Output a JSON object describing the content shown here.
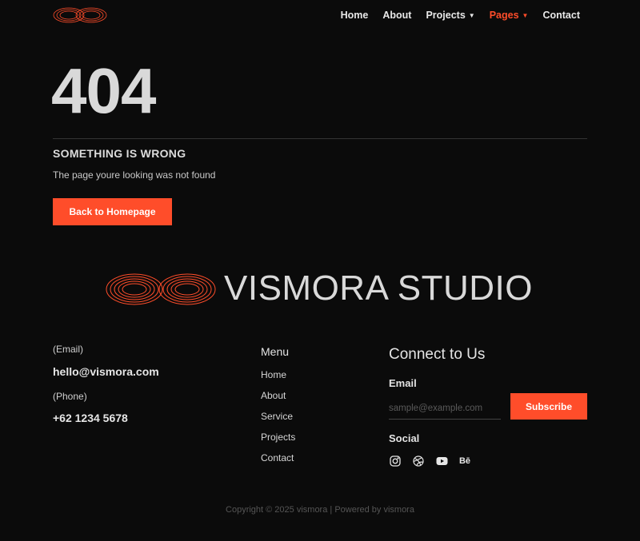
{
  "brand": {
    "name": "VISMORA STUDIO",
    "accent": "#ff4d2a"
  },
  "nav": {
    "items": [
      {
        "label": "Home"
      },
      {
        "label": "About"
      },
      {
        "label": "Projects"
      },
      {
        "label": "Pages"
      },
      {
        "label": "Contact"
      }
    ]
  },
  "error": {
    "code": "404",
    "title": "SOMETHING IS WRONG",
    "message": "The page youre looking was not found",
    "button": "Back to Homepage"
  },
  "footer": {
    "email_label": "(Email)",
    "email": "hello@vismora.com",
    "phone_label": "(Phone)",
    "phone": "+62 1234 5678",
    "menu_title": "Menu",
    "menu": [
      "Home",
      "About",
      "Service",
      "Projects",
      "Contact"
    ],
    "connect_title": "Connect to Us",
    "newsletter_label": "Email",
    "newsletter_placeholder": "sample@example.com",
    "subscribe": "Subscribe",
    "social_label": "Social",
    "social_icons": [
      "instagram-icon",
      "dribbble-icon",
      "youtube-icon",
      "behance-icon"
    ],
    "behance_glyph": "Bē",
    "copyright": "Copyright © 2025 vismora | Powered by vismora"
  }
}
